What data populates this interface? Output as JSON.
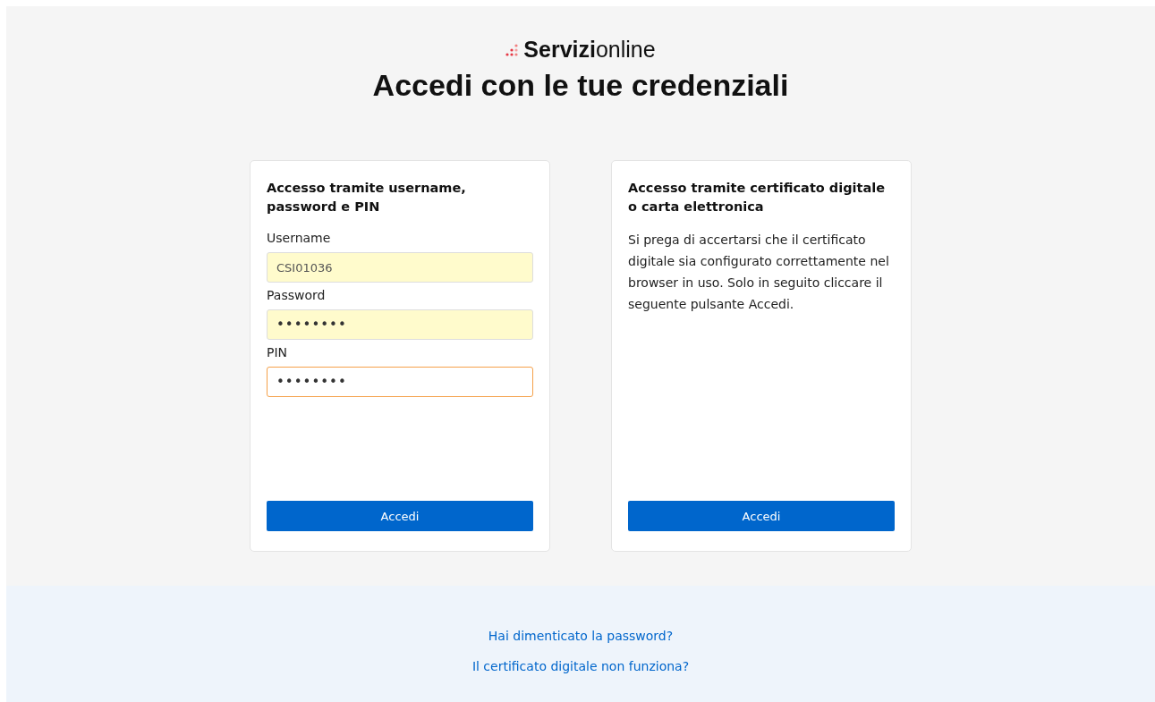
{
  "logo": {
    "text": "**Servizi**online"
  },
  "title": "Accedi con le tue credenziali",
  "cards": [
    {
      "kind": "form",
      "heading": "Accesso tramite username, password e PIN",
      "fields": [
        {
          "label": "Username",
          "value": "CSI01036",
          "autofilled": true,
          "focused": false
        },
        {
          "label": "Password",
          "value": "••••••••",
          "autofilled": true,
          "focused": false
        },
        {
          "label": "PIN",
          "value": "••••••••",
          "autofilled": false,
          "focused": true
        }
      ],
      "button": "Accedi"
    },
    {
      "kind": "text",
      "heading": "Accesso tramite certificato digitale o carta elettronica",
      "body": "Si prega di accertarsi che il certificato digitale sia configurato correttamente nel browser in uso. Solo in seguito cliccare il seguente pulsante Accedi.",
      "button": "Accedi"
    }
  ],
  "footer_links": [
    "Hai dimenticato la password?",
    "Il certificato digitale non funziona?"
  ]
}
